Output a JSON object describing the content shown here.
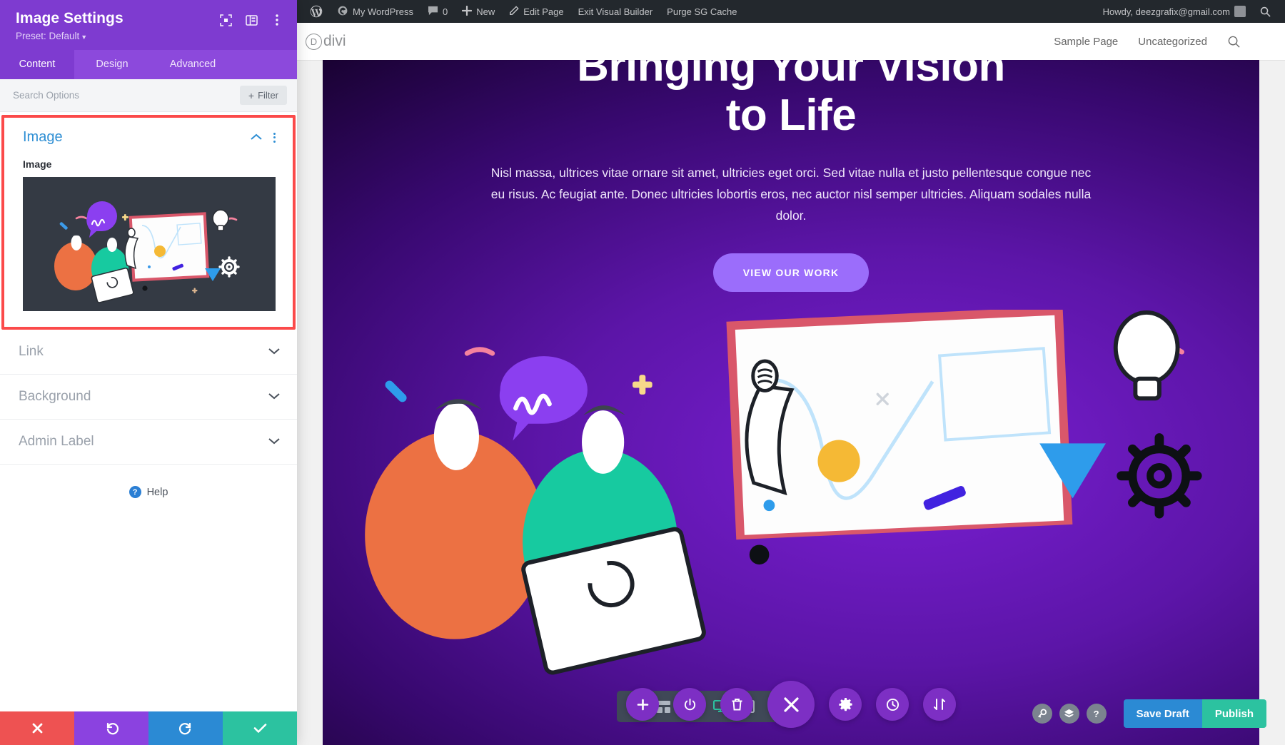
{
  "panel": {
    "title": "Image Settings",
    "preset": "Preset: Default",
    "tabs": [
      {
        "label": "Content",
        "active": true
      },
      {
        "label": "Design",
        "active": false
      },
      {
        "label": "Advanced",
        "active": false
      }
    ],
    "search_placeholder": "Search Options",
    "filter_label": "Filter",
    "open_section": {
      "title": "Image",
      "field_label": "Image"
    },
    "closed_sections": [
      {
        "title": "Link"
      },
      {
        "title": "Background"
      },
      {
        "title": "Admin Label"
      }
    ],
    "help_label": "Help",
    "footer": [
      {
        "name": "discard",
        "icon": "close-icon",
        "color": "#ee5252"
      },
      {
        "name": "undo",
        "icon": "undo-icon",
        "color": "#8b42e0"
      },
      {
        "name": "redo",
        "icon": "redo-icon",
        "color": "#2b8ad4"
      },
      {
        "name": "save",
        "icon": "check-icon",
        "color": "#2cc2a0"
      }
    ],
    "accent": "#7e3bd0",
    "highlight_color": "#fb4a4a"
  },
  "adminbar": {
    "items": [
      {
        "label": "My WordPress",
        "icon": "dashboard-icon"
      },
      {
        "label": "0",
        "icon": "comment-icon"
      },
      {
        "label": "New",
        "icon": "plus-icon"
      },
      {
        "label": "Edit Page",
        "icon": "pencil-icon"
      },
      {
        "label": "Exit Visual Builder",
        "icon": ""
      },
      {
        "label": "Purge SG Cache",
        "icon": ""
      }
    ],
    "howdy": "Howdy, deezgrafix@gmail.com"
  },
  "site": {
    "logo": "divi",
    "logo_mark": "D",
    "nav": [
      "Sample Page",
      "Uncategorized"
    ]
  },
  "hero": {
    "title_line1": "Bringing Your Vision",
    "title_line2": "to Life",
    "paragraph": "Nisl massa, ultrices vitae ornare sit amet, ultricies eget orci. Sed vitae nulla et justo pellentesque congue nec eu risus. Ac feugiat ante. Donec ultricies lobortis eros, nec auctor nisl semper ultricies. Aliquam sodales nulla dolor.",
    "cta": "VIEW OUR WORK"
  },
  "builder": {
    "view_tools": [
      {
        "name": "more-options",
        "icon": "kebab-icon",
        "active": false
      },
      {
        "name": "wireframe-view",
        "icon": "wireframe-icon",
        "active": false
      },
      {
        "name": "zoom-view",
        "icon": "magnifier-icon",
        "active": false
      },
      {
        "name": "desktop-view",
        "icon": "desktop-icon",
        "active": true
      },
      {
        "name": "tablet-view",
        "icon": "tablet-icon",
        "active": false
      },
      {
        "name": "phone-view",
        "icon": "phone-icon",
        "active": false
      }
    ],
    "circle_tools": [
      {
        "name": "add-module",
        "icon": "plus-icon",
        "big": false
      },
      {
        "name": "page-settings",
        "icon": "power-icon",
        "big": false
      },
      {
        "name": "delete-layout",
        "icon": "trash-icon",
        "big": false
      },
      {
        "name": "close-builder",
        "icon": "close-icon",
        "big": true
      },
      {
        "name": "builder-settings",
        "icon": "gear-icon",
        "big": false
      },
      {
        "name": "editing-history",
        "icon": "clock-icon",
        "big": false
      },
      {
        "name": "portability",
        "icon": "sort-icon",
        "big": false
      }
    ],
    "right_tools": [
      {
        "name": "search-layout",
        "icon": "magnifier-icon"
      },
      {
        "name": "layers-view",
        "icon": "layers-icon"
      },
      {
        "name": "help",
        "icon": "question-icon"
      }
    ],
    "save_draft": "Save Draft",
    "publish": "Publish"
  }
}
